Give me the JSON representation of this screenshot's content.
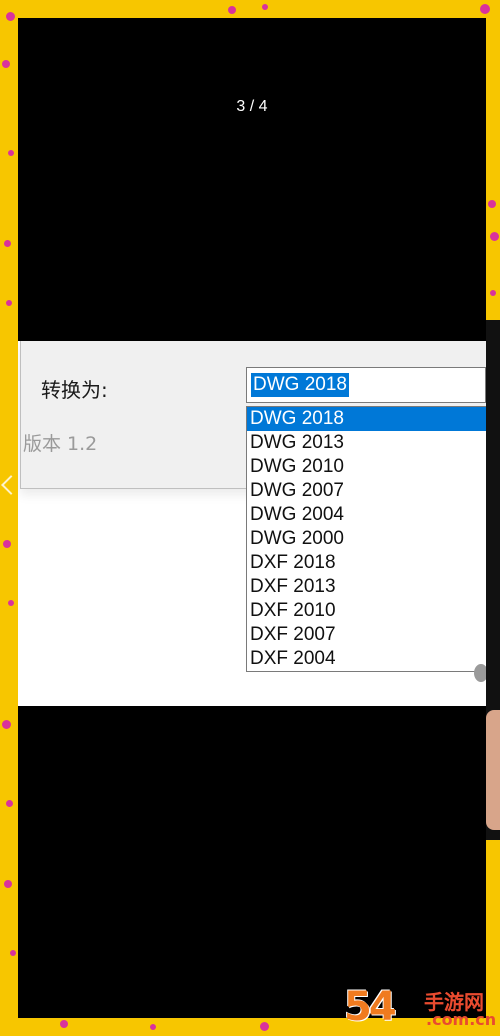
{
  "viewer": {
    "page_counter": "3 / 4"
  },
  "dialog": {
    "convert_label": "转换为:",
    "version_label": "版本 1.2",
    "selected_format": "DWG 2018",
    "options": [
      "DWG 2018",
      "DWG 2013",
      "DWG 2010",
      "DWG 2007",
      "DWG 2004",
      "DWG 2000",
      "DXF 2018",
      "DXF 2013",
      "DXF 2010",
      "DXF 2007",
      "DXF 2004"
    ],
    "highlighted_option": "DWG 2018"
  },
  "watermark": {
    "number": "54",
    "brand": "手游网",
    "domain": ".com.cn"
  },
  "colors": {
    "frame_background": "#f7c600",
    "dots": "#d9329c",
    "selection": "#0078d7"
  }
}
